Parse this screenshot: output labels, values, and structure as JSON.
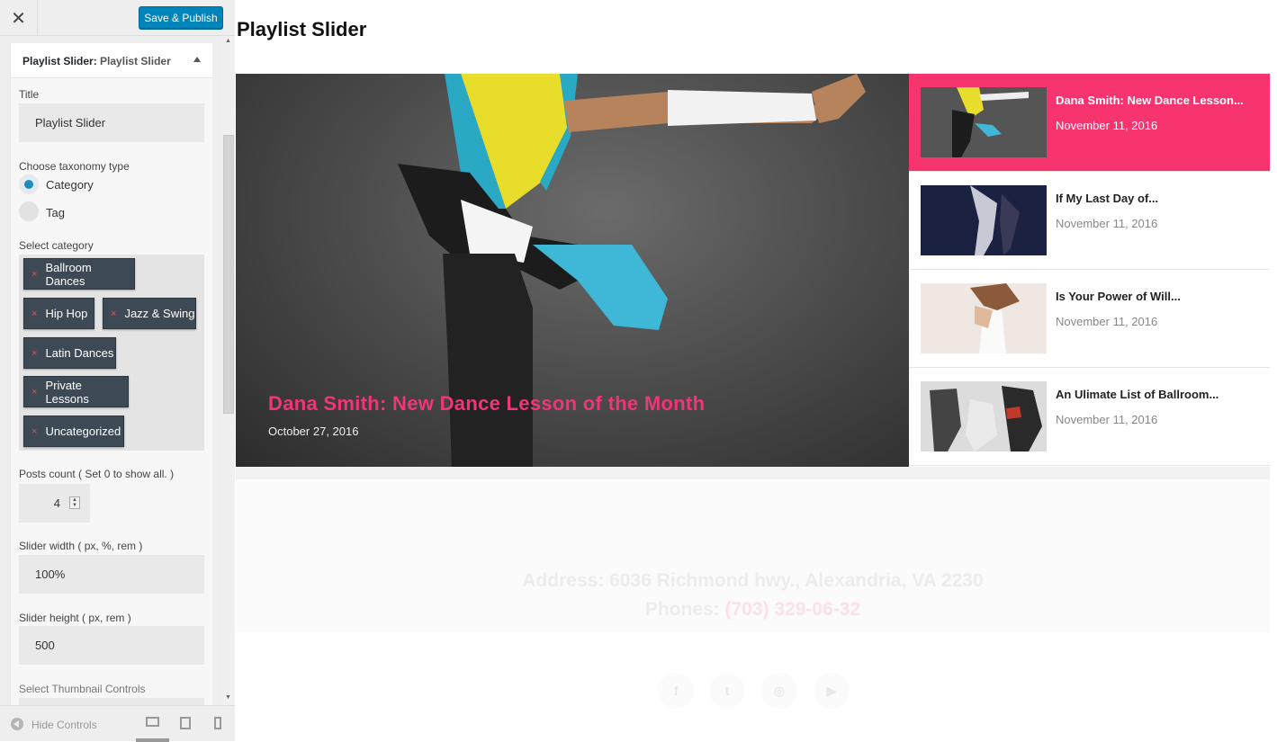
{
  "topbar": {
    "close_glyph": "✕",
    "save_label": "Save & Publish"
  },
  "widget": {
    "header_label": "Playlist Slider:",
    "header_sub": "Playlist Slider",
    "title_label": "Title",
    "title_value": "Playlist Slider",
    "taxonomy_label": "Choose taxonomy type",
    "taxonomy_options": [
      {
        "label": "Category",
        "selected": true
      },
      {
        "label": "Tag",
        "selected": false
      }
    ],
    "category_label": "Select category",
    "categories": [
      "Ballroom Dances",
      "Hip Hop",
      "Jazz & Swing",
      "Latin Dances",
      "Private Lessons",
      "Uncategorized"
    ],
    "tag_remove_glyph": "×",
    "posts_count_label": "Posts count ( Set 0 to show all. )",
    "posts_count_value": "4",
    "width_label": "Slider width ( px, %, rem )",
    "width_value": "100%",
    "height_label": "Slider height ( px, rem )",
    "height_value": "500",
    "thumb_controls_label": "Select Thumbnail Controls"
  },
  "footer": {
    "hide_controls_label": "Hide Controls"
  },
  "preview": {
    "page_title": "Playlist Slider",
    "hero": {
      "title": "Dana Smith: New Dance Lesson of the Month",
      "date": "October 27, 2016"
    },
    "playlist": [
      {
        "title": "Dana Smith: New Dance Lesson...",
        "date": "November 11, 2016",
        "active": true
      },
      {
        "title": "If My Last Day of...",
        "date": "November 11, 2016",
        "active": false
      },
      {
        "title": "Is Your Power of Will...",
        "date": "November 11, 2016",
        "active": false
      },
      {
        "title": "An Ulimate List of Ballroom...",
        "date": "November 11, 2016",
        "active": false
      }
    ],
    "address": "Address: 6036 Richmond hwy., Alexandria, VA 2230",
    "phones_label": "Phones:",
    "phones_number": "(703) 329-06-32",
    "social_icons": [
      {
        "name": "facebook-icon",
        "glyph": "f"
      },
      {
        "name": "twitter-icon",
        "glyph": "t"
      },
      {
        "name": "instagram-icon",
        "glyph": "◎"
      },
      {
        "name": "youtube-icon",
        "glyph": "▶"
      }
    ]
  },
  "colors": {
    "accent": "#f7346d",
    "primary_button": "#0085ba",
    "tag_bg": "#3d4a56"
  }
}
